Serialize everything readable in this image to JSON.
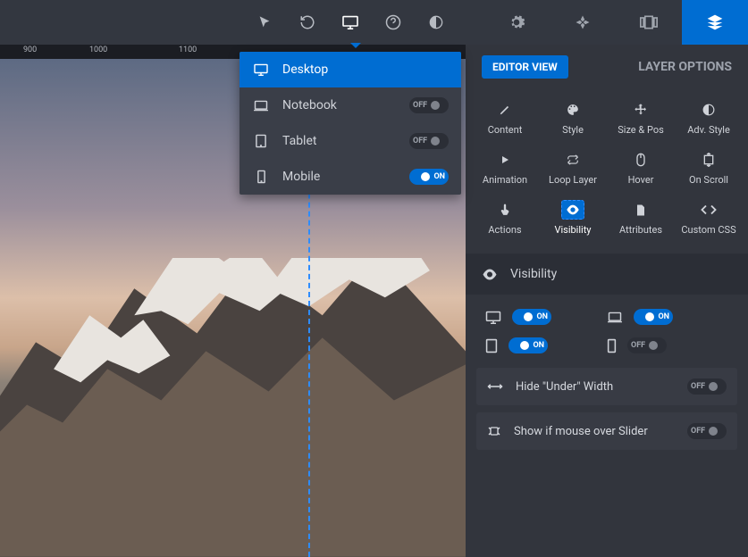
{
  "ruler": {
    "marks": [
      "900",
      "1000",
      "1100"
    ]
  },
  "toolbar_dropdown": {
    "items": [
      {
        "label": "Desktop",
        "on": null,
        "active": true,
        "icon": "desktop"
      },
      {
        "label": "Notebook",
        "on": false,
        "active": false,
        "icon": "notebook"
      },
      {
        "label": "Tablet",
        "on": false,
        "active": false,
        "icon": "tablet"
      },
      {
        "label": "Mobile",
        "on": true,
        "active": false,
        "icon": "mobile"
      }
    ],
    "off_text": "OFF",
    "on_text": "ON"
  },
  "panel": {
    "editor_view": "EDITOR VIEW",
    "layer_options": "LAYER OPTIONS",
    "tools": [
      {
        "label": "Content",
        "icon": "pencil"
      },
      {
        "label": "Style",
        "icon": "palette"
      },
      {
        "label": "Size & Pos",
        "icon": "move"
      },
      {
        "label": "Adv. Style",
        "icon": "halfcircle"
      },
      {
        "label": "Animation",
        "icon": "play"
      },
      {
        "label": "Loop Layer",
        "icon": "loop"
      },
      {
        "label": "Hover",
        "icon": "mouse"
      },
      {
        "label": "On Scroll",
        "icon": "scroll"
      },
      {
        "label": "Actions",
        "icon": "tap"
      },
      {
        "label": "Visibility",
        "icon": "eyebox",
        "active": true
      },
      {
        "label": "Attributes",
        "icon": "file"
      },
      {
        "label": "Custom CSS",
        "icon": "code"
      }
    ],
    "visibility": {
      "title": "Visibility",
      "devices": [
        {
          "icon": "desktop",
          "on": true
        },
        {
          "icon": "notebook",
          "on": true
        },
        {
          "icon": "tablet",
          "on": true
        },
        {
          "icon": "mobile",
          "on": false
        }
      ],
      "rows": [
        {
          "label": "Hide \"Under\" Width",
          "on": false,
          "icon": "hwidth"
        },
        {
          "label": "Show if mouse over Slider",
          "on": false,
          "icon": "target"
        }
      ]
    }
  },
  "toggle": {
    "on": "ON",
    "off": "OFF"
  }
}
